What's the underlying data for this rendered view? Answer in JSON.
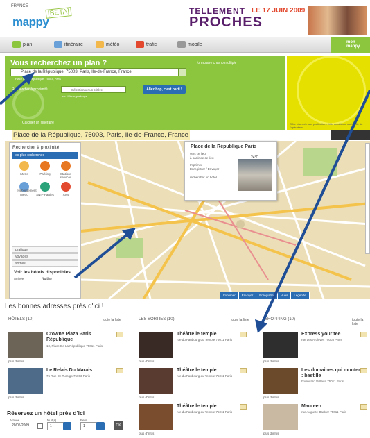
{
  "header": {
    "region": "FRANCE",
    "logo": "mappy",
    "beta": "[BETA]",
    "banner": {
      "line1": "TELLEMENT",
      "line2": "PROCHES",
      "date": "LE 17 JUIN 2009"
    }
  },
  "nav": {
    "items": [
      {
        "label": "plan",
        "icon": "map-icon",
        "color": "#8cc63f"
      },
      {
        "label": "itinéraire",
        "icon": "route-icon",
        "color": "#6aa0d8"
      },
      {
        "label": "météo",
        "icon": "weather-icon",
        "color": "#f2b84b"
      },
      {
        "label": "trafic",
        "icon": "traffic-icon",
        "color": "#e2492e"
      },
      {
        "label": "mobile",
        "icon": "mobile-icon",
        "color": "#999999"
      }
    ],
    "mon_mappy": "mon mappy"
  },
  "search": {
    "title": "Vous recherchez un plan ?",
    "multi_link": "formulaire champ multiple",
    "value": "Place de la République, 75003, Paris, Ile-de-France, France",
    "sub": "Place de la République, 75003, Paris",
    "proximity_label": "Rechercher à proximité",
    "select_placeholder": "Sélectionner un critère",
    "select_sub": "ex: Hôtels, parkings",
    "go_button": "Allez hop, c'est parti !",
    "itinerary_link": "Calculer un itinéraire"
  },
  "ad_text": "Offre réservée aux particuliers. Voir conditions sur le site de l'opérateur.",
  "address_bar": "Place de la République, 75003, Paris, Ile-de-France, France",
  "left_panel": {
    "title": "Rechercher à proximité",
    "tab": "les plus recherchés",
    "pois": [
      {
        "label": "Métro",
        "color": "#f2b84b"
      },
      {
        "label": "Parking",
        "color": "#e87722"
      },
      {
        "label": "Stations services",
        "color": "#e87722"
      },
      {
        "label": "Métro",
        "color": "#6aa0d8"
      },
      {
        "label": "SNIP Parties",
        "color": "#2aa37a"
      },
      {
        "label": "Avis",
        "color": "#e2492e"
      },
      {
        "label": "Hébergement",
        "color": "#6aa0d8"
      }
    ],
    "categories": [
      "pratique",
      "voyages",
      "sorties"
    ],
    "hotels_title": "Voir les hôtels disponibles",
    "arrival": "Arrivée",
    "nights": "Nuit(s)"
  },
  "popup": {
    "title": "Place de la République Paris",
    "links": [
      "vers ce lieu",
      "à partir de ce lieu",
      "Imprimer",
      "Enregistrer / Envoyer",
      "rechercher un hôtel"
    ],
    "temperature": "24°C"
  },
  "map_toolbar": [
    "Imprimer",
    "Envoyer",
    "Enregistrer",
    "Vues",
    "Légende"
  ],
  "section_title": "Les bonnes adresses près d'ici !",
  "columns": [
    {
      "heading": "HÔTELS (10)",
      "more": "toute la liste",
      "items": [
        {
          "name": "Crowne Plaza Paris République",
          "address": "10, Place De La République 75011 Paris",
          "img": "#6b6457"
        },
        {
          "name": "Le Relais Du Marais",
          "address": "76 Rue De Turbigo 75003 Paris",
          "img": "#4e6b8a"
        }
      ]
    },
    {
      "heading": "LES SORTIES (10)",
      "more": "toute la liste",
      "items": [
        {
          "name": "Théâtre le temple",
          "address": "rue du Faubourg du Temple 75011 Paris",
          "img": "#3a2a26"
        },
        {
          "name": "Théâtre le temple",
          "address": "rue du Faubourg du Temple 75011 Paris",
          "img": "#5a3b30"
        },
        {
          "name": "Théâtre le temple",
          "address": "rue du Faubourg du Temple 75011 Paris",
          "img": "#7a4d2e"
        }
      ]
    },
    {
      "heading": "SHOPPING (10)",
      "more": "toute la liste",
      "items": [
        {
          "name": "Express your tee",
          "address": "rue des Archives 75003 Paris",
          "img": "#2e2e2e"
        },
        {
          "name": "Les domaines qui montent : bastille",
          "address": "boulevard Voltaire 75011 Paris",
          "img": "#6a4a2a"
        },
        {
          "name": "Maureen",
          "address": "rue Auguste-Barbier 75011 Paris",
          "img": "#c9b9a3"
        }
      ]
    }
  ],
  "plus_info": "plus d'infos",
  "reservation": {
    "title": "Réservez un hôtel près d'ici",
    "arrival": "Arrivée",
    "date": "20/05/2009",
    "nights": "Nuit(s)",
    "nights_value": "1",
    "pers": "Pers.",
    "pers_value": "1",
    "ok": "OK"
  }
}
